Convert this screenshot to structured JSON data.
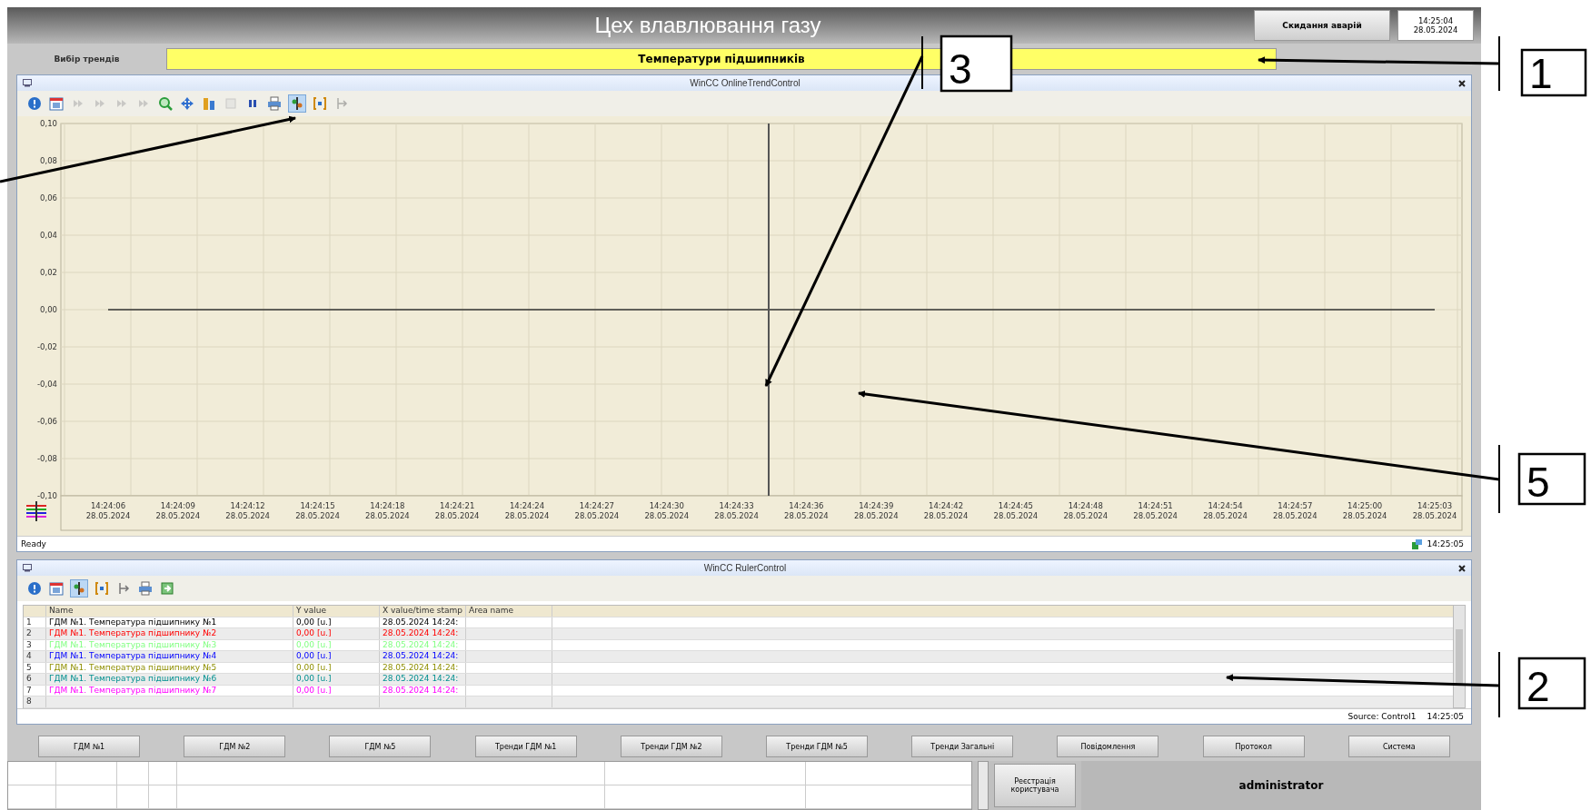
{
  "header": {
    "title": "Цех влавлювання газу",
    "reset_button": "Скидання аварій",
    "time": "14:25:04",
    "date": "28.05.2024"
  },
  "trend_select": {
    "label": "Вибір трендів",
    "value": "Температури підшипників"
  },
  "trend_window": {
    "title": "WinCC OnlineTrendControl",
    "status": "Ready",
    "status_time": "14:25:05",
    "chart_data": {
      "type": "line",
      "categories": [
        "14:24:06 28.05.2024",
        "14:24:09 28.05.2024",
        "14:24:12 28.05.2024",
        "14:24:15 28.05.2024",
        "14:24:18 28.05.2024",
        "14:24:21 28.05.2024",
        "14:24:24 28.05.2024",
        "14:24:27 28.05.2024",
        "14:24:30 28.05.2024",
        "14:24:33 28.05.2024",
        "14:24:36 28.05.2024",
        "14:24:39 28.05.2024",
        "14:24:42 28.05.2024",
        "14:24:45 28.05.2024",
        "14:24:48 28.05.2024",
        "14:24:51 28.05.2024",
        "14:24:54 28.05.2024",
        "14:24:57 28.05.2024",
        "14:25:00 28.05.2024",
        "14:25:03 28.05.2024"
      ],
      "series": [
        {
          "color": "#333333",
          "values": [
            0,
            0,
            0,
            0,
            0,
            0,
            0,
            0,
            0,
            0,
            0,
            0,
            0,
            0,
            0,
            0,
            0,
            0,
            0,
            0
          ]
        }
      ],
      "ylim": [
        -0.1,
        0.1
      ],
      "grid": true,
      "yticks": [
        {
          "value": 0.1,
          "label": "0,10"
        },
        {
          "value": 0.08,
          "label": "0,08"
        },
        {
          "value": 0.06,
          "label": "0,06"
        },
        {
          "value": 0.04,
          "label": "0,04"
        },
        {
          "value": 0.02,
          "label": "0,02"
        },
        {
          "value": 0,
          "label": "0,00"
        },
        {
          "value": -0.02,
          "label": "-0,02"
        },
        {
          "value": -0.04,
          "label": "-0,04"
        },
        {
          "value": -0.06,
          "label": "-0,06"
        },
        {
          "value": -0.08,
          "label": "-0,08"
        },
        {
          "value": -0.1,
          "label": "-0,10"
        }
      ]
    }
  },
  "ruler_window": {
    "title": "WinCC RulerControl",
    "columns": [
      "Name",
      "Y value",
      "X value/time stamp",
      "Area name"
    ],
    "rows": [
      {
        "number": "1",
        "name": "ГДМ №1. Температура підшипнику №1",
        "y_value": "0,00 [u.]",
        "x_value": "28.05.2024 14:24:",
        "color": "#000000"
      },
      {
        "number": "2",
        "name": "ГДМ №1. Температура підшипнику №2",
        "y_value": "0,00 [u.]",
        "x_value": "28.05.2024 14:24:",
        "color": "#ff0000"
      },
      {
        "number": "3",
        "name": "ГДМ №1. Температура підшипнику №3",
        "y_value": "0,00 [u.]",
        "x_value": "28.05.2024 14:24:",
        "color": "#80ff80"
      },
      {
        "number": "4",
        "name": "ГДМ №1. Температура підшипнику №4",
        "y_value": "0,00 [u.]",
        "x_value": "28.05.2024 14:24:",
        "color": "#0000ff"
      },
      {
        "number": "5",
        "name": "ГДМ №1. Температура підшипнику №5",
        "y_value": "0,00 [u.]",
        "x_value": "28.05.2024 14:24:",
        "color": "#8f8f00"
      },
      {
        "number": "6",
        "name": "ГДМ №1. Температура підшипнику №6",
        "y_value": "0,00 [u.]",
        "x_value": "28.05.2024 14:24:",
        "color": "#008f8f"
      },
      {
        "number": "7",
        "name": "ГДМ №1. Температура підшипнику №7",
        "y_value": "0,00 [u.]",
        "x_value": "28.05.2024 14:24:",
        "color": "#ff00ff"
      },
      {
        "number": "8"
      }
    ],
    "source": "Source: Control1",
    "source_time": "14:25:05"
  },
  "nav_buttons": [
    "ГДМ №1",
    "ГДМ №2",
    "ГДМ №5",
    "Тренди ГДМ №1",
    "Тренди ГДМ №2",
    "Тренди ГДМ №5",
    "Тренди Загальні",
    "Повідомлення",
    "Протокол",
    "Система"
  ],
  "footer": {
    "login_button": "Реєстрація користувача",
    "user": "administrator"
  },
  "callouts": [
    {
      "label": "3"
    },
    {
      "label": "1"
    },
    {
      "label": "5"
    },
    {
      "label": "2"
    }
  ]
}
